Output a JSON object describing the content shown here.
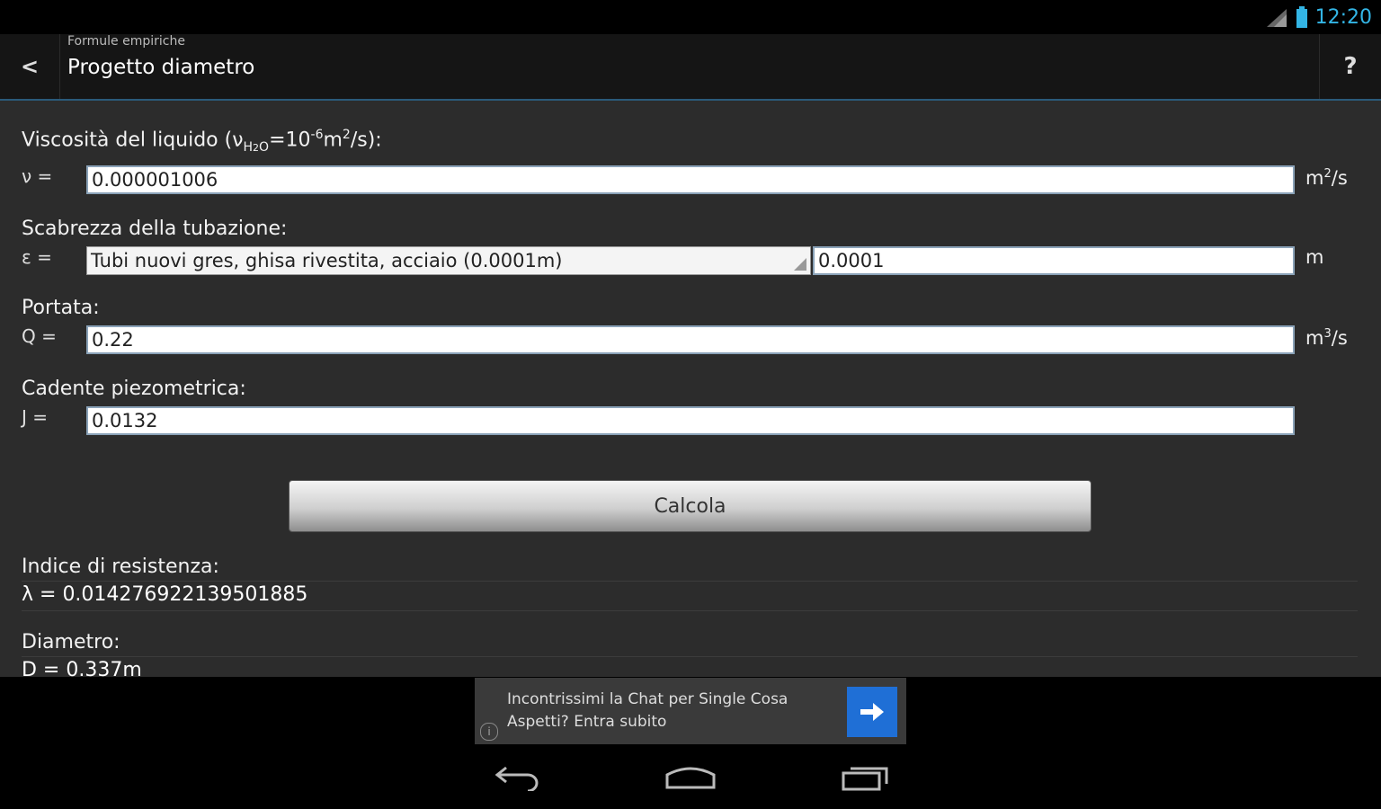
{
  "status": {
    "time": "12:20"
  },
  "actionbar": {
    "subtitle": "Formule empiriche",
    "title": "Progetto diametro",
    "back_icon": "<",
    "help_icon": "?"
  },
  "viscosity": {
    "label_prefix": "Viscosità del liquido (ν",
    "label_sub": "H",
    "label_sub2": "2",
    "label_sub3": "O",
    "label_mid": "=10",
    "label_exp": "-6",
    "label_unit_base": "m",
    "label_unit_exp": "2",
    "label_suffix": "/s):",
    "symbol": "ν =",
    "value": "0.000001006",
    "unit_base": "m",
    "unit_exp": "2",
    "unit_suffix": "/s"
  },
  "roughness": {
    "label": "Scabrezza della tubazione:",
    "symbol": "ε =",
    "selected_option": "Tubi nuovi gres, ghisa rivestita, acciaio (0.0001m)",
    "value": "0.0001",
    "unit": "m"
  },
  "flow": {
    "label": "Portata:",
    "symbol": "Q =",
    "value": "0.22",
    "unit_base": "m",
    "unit_exp": "3",
    "unit_suffix": "/s"
  },
  "gradient": {
    "label": "Cadente piezometrica:",
    "symbol": "J =",
    "value": "0.0132"
  },
  "calc_button": "Calcola",
  "results": {
    "resistance_label": "Indice di resistenza:",
    "resistance_value": "λ = 0.014276922139501885",
    "diameter_label": "Diametro:",
    "diameter_value": "D = 0.337m"
  },
  "ad": {
    "line1": "Incontrissimi la Chat per Single Cosa",
    "line2": "Aspetti? Entra subito",
    "info": "i"
  },
  "colors": {
    "accent": "#33b5e5",
    "content_bg": "#2c2c2c",
    "ad_button": "#1f6fd6"
  }
}
